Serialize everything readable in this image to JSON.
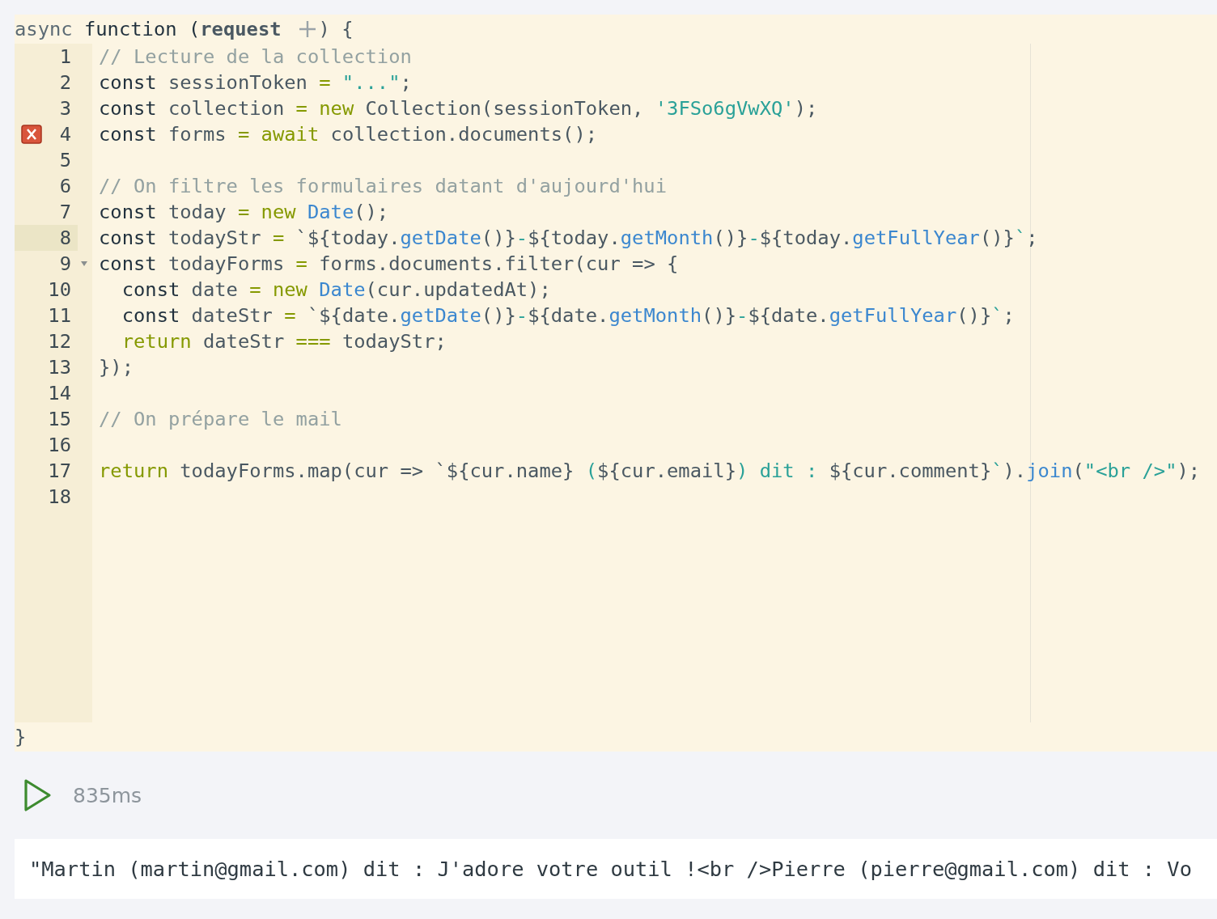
{
  "editor": {
    "signature": [
      {
        "kind": "mod",
        "text": "async "
      },
      {
        "kind": "kw",
        "text": "function ("
      },
      {
        "kind": "param",
        "text": "request"
      }
    ],
    "signature_end": ") {",
    "lines": [
      {
        "number": "1",
        "error": false,
        "active": false,
        "foldable": false,
        "tokens": [
          {
            "kind": "comment",
            "text": "// Lecture de la collection"
          }
        ]
      },
      {
        "number": "2",
        "error": false,
        "active": false,
        "foldable": false,
        "tokens": [
          {
            "kind": "kw",
            "text": "const"
          },
          {
            "kind": "plain",
            "text": " sessionToken "
          },
          {
            "kind": "op",
            "text": "="
          },
          {
            "kind": "str",
            "text": " \"...\""
          },
          {
            "kind": "plain",
            "text": ";"
          }
        ]
      },
      {
        "number": "3",
        "error": false,
        "active": false,
        "foldable": false,
        "tokens": [
          {
            "kind": "kw",
            "text": "const"
          },
          {
            "kind": "plain",
            "text": " collection "
          },
          {
            "kind": "op",
            "text": "= new"
          },
          {
            "kind": "plain",
            "text": " Collection(sessionToken, "
          },
          {
            "kind": "str",
            "text": "'3FSo6gVwXQ'"
          },
          {
            "kind": "plain",
            "text": ");"
          }
        ]
      },
      {
        "number": "4",
        "error": true,
        "active": false,
        "foldable": false,
        "tokens": [
          {
            "kind": "kw",
            "text": "const"
          },
          {
            "kind": "plain",
            "text": " forms "
          },
          {
            "kind": "op",
            "text": "= await"
          },
          {
            "kind": "plain",
            "text": " collection.documents();"
          }
        ]
      },
      {
        "number": "5",
        "error": false,
        "active": false,
        "foldable": false
      },
      {
        "number": "6",
        "error": false,
        "active": false,
        "foldable": false,
        "tokens": [
          {
            "kind": "comment",
            "text": "// On filtre les formulaires datant d'aujourd'hui"
          }
        ]
      },
      {
        "number": "7",
        "error": false,
        "active": false,
        "foldable": false,
        "tokens": [
          {
            "kind": "kw",
            "text": "const"
          },
          {
            "kind": "plain",
            "text": " today "
          },
          {
            "kind": "op",
            "text": "= new"
          },
          {
            "kind": "fn",
            "text": " Date"
          },
          {
            "kind": "plain",
            "text": "();"
          }
        ]
      },
      {
        "number": "8",
        "error": false,
        "active": true,
        "foldable": false,
        "tokens": [
          {
            "kind": "kw",
            "text": "const"
          },
          {
            "kind": "plain",
            "text": " todayStr "
          },
          {
            "kind": "op",
            "text": "="
          },
          {
            "kind": "plain",
            "text": " `${today."
          },
          {
            "kind": "fn",
            "text": "getDate"
          },
          {
            "kind": "plain",
            "text": "()}"
          },
          {
            "kind": "str",
            "text": "-"
          },
          {
            "kind": "plain",
            "text": "${today."
          },
          {
            "kind": "fn",
            "text": "getMonth"
          },
          {
            "kind": "plain",
            "text": "()}"
          },
          {
            "kind": "str",
            "text": "-"
          },
          {
            "kind": "plain",
            "text": "${today."
          },
          {
            "kind": "fn",
            "text": "getFullYear"
          },
          {
            "kind": "plain",
            "text": "()}"
          },
          {
            "kind": "str",
            "text": "`"
          },
          {
            "kind": "plain",
            "text": ";"
          }
        ]
      },
      {
        "number": "9",
        "error": false,
        "active": false,
        "foldable": true,
        "tokens": [
          {
            "kind": "kw",
            "text": "const"
          },
          {
            "kind": "plain",
            "text": " todayForms "
          },
          {
            "kind": "op",
            "text": "="
          },
          {
            "kind": "plain",
            "text": " forms.documents.filter(cur => {"
          }
        ]
      },
      {
        "number": "10",
        "error": false,
        "active": false,
        "foldable": false,
        "tokens": [
          {
            "kind": "kw",
            "text": "  const"
          },
          {
            "kind": "plain",
            "text": " date "
          },
          {
            "kind": "op",
            "text": "= new"
          },
          {
            "kind": "fn",
            "text": " Date"
          },
          {
            "kind": "plain",
            "text": "(cur.updatedAt);"
          }
        ]
      },
      {
        "number": "11",
        "error": false,
        "active": false,
        "foldable": false,
        "tokens": [
          {
            "kind": "kw",
            "text": "  const"
          },
          {
            "kind": "plain",
            "text": " dateStr "
          },
          {
            "kind": "op",
            "text": "="
          },
          {
            "kind": "plain",
            "text": " `${date."
          },
          {
            "kind": "fn",
            "text": "getDate"
          },
          {
            "kind": "plain",
            "text": "()}"
          },
          {
            "kind": "str",
            "text": "-"
          },
          {
            "kind": "plain",
            "text": "${date."
          },
          {
            "kind": "fn",
            "text": "getMonth"
          },
          {
            "kind": "plain",
            "text": "()}"
          },
          {
            "kind": "str",
            "text": "-"
          },
          {
            "kind": "plain",
            "text": "${date."
          },
          {
            "kind": "fn",
            "text": "getFullYear"
          },
          {
            "kind": "plain",
            "text": "()}"
          },
          {
            "kind": "str",
            "text": "`"
          },
          {
            "kind": "plain",
            "text": ";"
          }
        ]
      },
      {
        "number": "12",
        "error": false,
        "active": false,
        "foldable": false,
        "tokens": [
          {
            "kind": "op",
            "text": "  return"
          },
          {
            "kind": "plain",
            "text": " dateStr "
          },
          {
            "kind": "op",
            "text": "==="
          },
          {
            "kind": "plain",
            "text": " todayStr;"
          }
        ]
      },
      {
        "number": "13",
        "error": false,
        "active": false,
        "foldable": false,
        "tokens": [
          {
            "kind": "plain",
            "text": "});"
          }
        ]
      },
      {
        "number": "14",
        "error": false,
        "active": false,
        "foldable": false
      },
      {
        "number": "15",
        "error": false,
        "active": false,
        "foldable": false,
        "tokens": [
          {
            "kind": "comment",
            "text": "// On prépare le mail"
          }
        ]
      },
      {
        "number": "16",
        "error": false,
        "active": false,
        "foldable": false
      },
      {
        "number": "17",
        "error": false,
        "active": false,
        "foldable": false,
        "tokens": [
          {
            "kind": "op",
            "text": "return"
          },
          {
            "kind": "plain",
            "text": " todayForms.map(cur => `${cur.name}"
          },
          {
            "kind": "str",
            "text": " ("
          },
          {
            "kind": "plain",
            "text": "${cur.email}"
          },
          {
            "kind": "str",
            "text": ") dit : "
          },
          {
            "kind": "plain",
            "text": "${cur.comment}"
          },
          {
            "kind": "str",
            "text": "`"
          },
          {
            "kind": "plain",
            "text": ")."
          },
          {
            "kind": "fn",
            "text": "join"
          },
          {
            "kind": "plain",
            "text": "("
          },
          {
            "kind": "str",
            "text": "\"<br />\""
          },
          {
            "kind": "plain",
            "text": ");"
          }
        ]
      },
      {
        "number": "18",
        "error": false,
        "active": false,
        "foldable": false
      }
    ],
    "closing": "}"
  },
  "run": {
    "duration": "835ms"
  },
  "output": {
    "text": "\"Martin (martin@gmail.com) dit : J'adore votre outil !<br />Pierre (pierre@gmail.com) dit : Vo"
  }
}
